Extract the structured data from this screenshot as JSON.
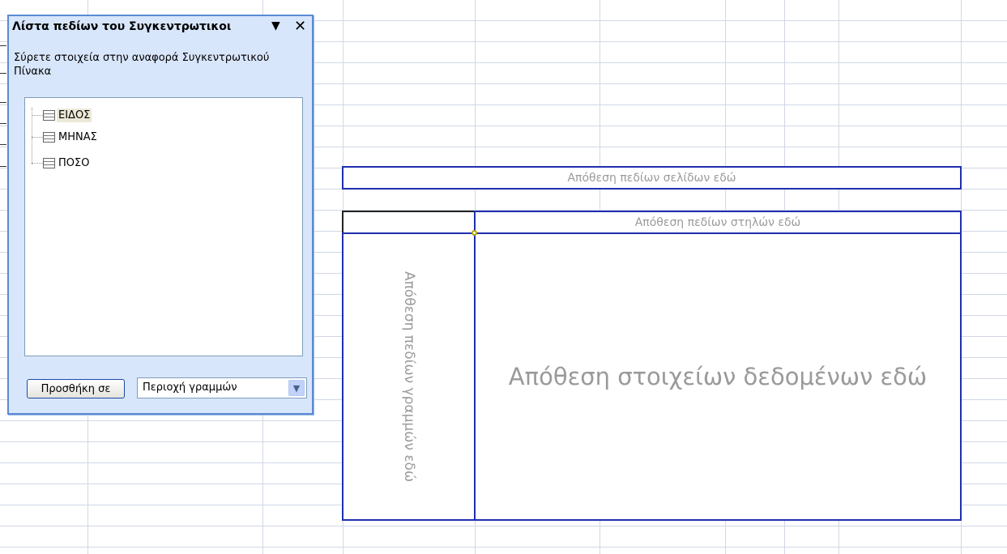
{
  "task_pane": {
    "title": "Λίστα πεδίων του Συγκεντρωτικοι",
    "dropdown_glyph": "▼",
    "close_glyph": "✕",
    "instructions": "Σύρετε στοιχεία στην αναφορά Συγκεντρωτικού Πίνακα",
    "fields": [
      {
        "label": "ΕΙΔΟΣ",
        "selected": true
      },
      {
        "label": "ΜΗΝΑΣ",
        "selected": false
      },
      {
        "label": "ΠΟΣΟ",
        "selected": false
      }
    ],
    "add_to_button_label": "Προσθήκη σε",
    "area_select_value": "Περιοχή γραμμών",
    "area_select_arrow": "▼"
  },
  "pivot": {
    "page_fields_hint": "Απόθεση πεδίων σελίδων εδώ",
    "column_fields_hint": "Απόθεση πεδίων στηλών εδώ",
    "row_fields_hint": "Απόθεση πεδίων γραμμών εδώ",
    "data_items_hint": "Απόθεση στοιχείων δεδομένων εδώ"
  },
  "colors": {
    "drop_border": "#1f2fb0",
    "pane_background": "#d8e6fb",
    "pane_border": "#5a8ad4",
    "gridline": "#d0d7e5"
  }
}
